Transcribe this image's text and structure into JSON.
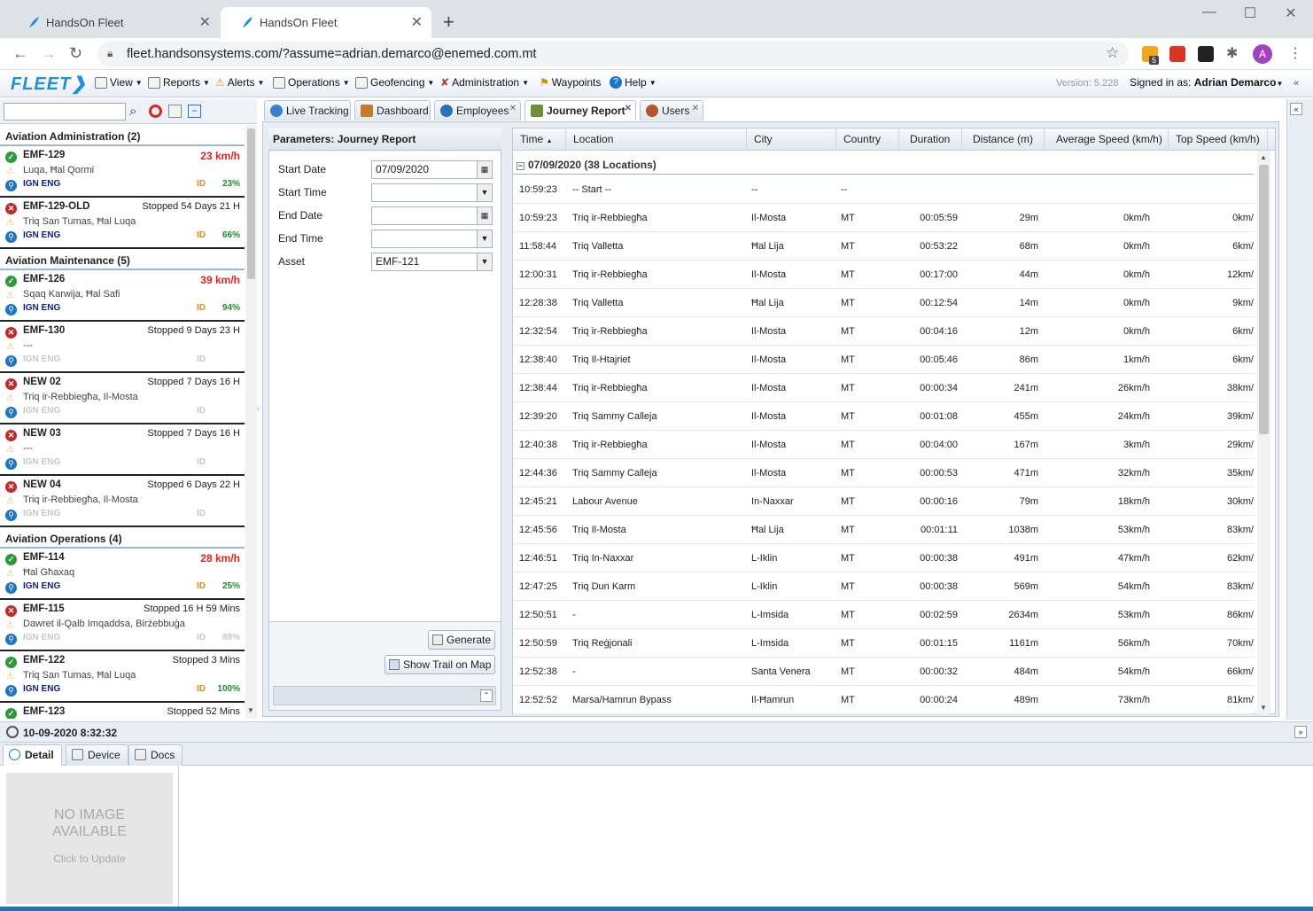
{
  "browser": {
    "tabs": [
      {
        "title": "HandsOn Fleet"
      },
      {
        "title": "HandsOn Fleet"
      }
    ],
    "url": "fleet.handsonsystems.com/?assume=adrian.demarco@enemed.com.mt",
    "profile_initial": "A",
    "ext_badge": "5"
  },
  "app": {
    "logo": "FLEET❯",
    "menu": [
      "View",
      "Reports",
      "Alerts",
      "Operations",
      "Geofencing",
      "Administration",
      "Waypoints",
      "Help"
    ],
    "version": "Version: 5.228",
    "signed_in_label": "Signed in as:",
    "user": "Adrian Demarco"
  },
  "groups": [
    {
      "title": "Aviation Administration (2)",
      "assets": [
        {
          "name": "EMF-129",
          "status": "23 km/h",
          "moving": true,
          "addr": "Luqa, Ħal Qormi",
          "ign": "IGN ENG",
          "ign_on": true,
          "id": "ID",
          "pct": "23%",
          "ok": true
        },
        {
          "name": "EMF-129-OLD",
          "status": "Stopped 54 Days 21 H",
          "moving": false,
          "addr": "Triq San Tumas, Ħal Luqa",
          "ign": "IGN ENG",
          "ign_on": true,
          "id": "ID",
          "pct": "66%",
          "ok": false
        }
      ]
    },
    {
      "title": "Aviation Maintenance (5)",
      "assets": [
        {
          "name": "EMF-126",
          "status": "39 km/h",
          "moving": true,
          "addr": "Sqaq Karwija, Ħal Safi",
          "ign": "IGN ENG",
          "ign_on": true,
          "id": "ID",
          "pct": "94%",
          "ok": true
        },
        {
          "name": "EMF-130",
          "status": "Stopped 9 Days 23 H",
          "moving": false,
          "addr": "---",
          "ign": "IGN ENG",
          "ign_on": false,
          "id": "ID",
          "pct": "",
          "ok": false
        },
        {
          "name": "NEW 02",
          "status": "Stopped 7 Days 16 H",
          "moving": false,
          "addr": "Triq ir-Rebbiegħa, Il-Mosta",
          "ign": "IGN ENG",
          "ign_on": false,
          "id": "ID",
          "pct": "",
          "ok": false
        },
        {
          "name": "NEW 03",
          "status": "Stopped 7 Days 16 H",
          "moving": false,
          "addr": "---",
          "ign": "IGN ENG",
          "ign_on": false,
          "id": "ID",
          "pct": "",
          "ok": false
        },
        {
          "name": "NEW 04",
          "status": "Stopped 6 Days 22 H",
          "moving": false,
          "addr": "Triq ir-Rebbiegħa, Il-Mosta",
          "ign": "IGN ENG",
          "ign_on": false,
          "id": "ID",
          "pct": "",
          "ok": false
        }
      ]
    },
    {
      "title": "Aviation Operations (4)",
      "assets": [
        {
          "name": "EMF-114",
          "status": "28 km/h",
          "moving": true,
          "addr": "Ħal Għaxaq",
          "ign": "IGN ENG",
          "ign_on": true,
          "id": "ID",
          "pct": "25%",
          "ok": true
        },
        {
          "name": "EMF-115",
          "status": "Stopped 16 H 59 Mins",
          "moving": false,
          "addr": "Dawret il-Qalb Imqaddsa, Birżebbuġa",
          "ign": "IGN ENG",
          "ign_on": false,
          "id": "ID",
          "pct": "88%",
          "ok": false
        },
        {
          "name": "EMF-122",
          "status": "Stopped 3 Mins",
          "moving": false,
          "addr": "Triq San Tumas, Ħal Luqa",
          "ign": "IGN ENG",
          "ign_on": true,
          "id": "ID",
          "pct": "100%",
          "ok": true
        },
        {
          "name": "EMF-123",
          "status": "Stopped 52 Mins",
          "moving": false,
          "addr": "",
          "ign": "",
          "ign_on": false,
          "id": "",
          "pct": "",
          "ok": true
        }
      ]
    }
  ],
  "tabs": [
    "Live Tracking",
    "Dashboard",
    "Employees",
    "Journey Report",
    "Users"
  ],
  "params": {
    "title": "Parameters: Journey Report",
    "start_date_label": "Start Date",
    "start_date": "07/09/2020",
    "start_time_label": "Start Time",
    "start_time": "",
    "end_date_label": "End Date",
    "end_date": "",
    "end_time_label": "End Time",
    "end_time": "",
    "asset_label": "Asset",
    "asset": "EMF-121",
    "generate": "Generate",
    "show_trail": "Show Trail on Map"
  },
  "grid": {
    "columns": [
      "Time",
      "Location",
      "City",
      "Country",
      "Duration",
      "Distance (m)",
      "Average Speed (km/h)",
      "Top Speed (km/h)"
    ],
    "group": "07/09/2020 (38 Locations)",
    "rows": [
      [
        "10:59:23",
        "-- Start --",
        "--",
        "--",
        "",
        "",
        "",
        ""
      ],
      [
        "10:59:23",
        "Triq ir-Rebbiegħa",
        "Il-Mosta",
        "MT",
        "00:05:59",
        "29m",
        "0km/h",
        "0km/"
      ],
      [
        "11:58:44",
        "Triq Valletta",
        "Ħal Lija",
        "MT",
        "00:53:22",
        "68m",
        "0km/h",
        "6km/"
      ],
      [
        "12:00:31",
        "Triq ir-Rebbiegħa",
        "Il-Mosta",
        "MT",
        "00:17:00",
        "44m",
        "0km/h",
        "12km/"
      ],
      [
        "12:28:38",
        "Triq Valletta",
        "Ħal Lija",
        "MT",
        "00:12:54",
        "14m",
        "0km/h",
        "9km/"
      ],
      [
        "12:32:54",
        "Triq ir-Rebbiegħa",
        "Il-Mosta",
        "MT",
        "00:04:16",
        "12m",
        "0km/h",
        "6km/"
      ],
      [
        "12:38:40",
        "Triq Il-Htajriet",
        "Il-Mosta",
        "MT",
        "00:05:46",
        "86m",
        "1km/h",
        "6km/"
      ],
      [
        "12:38:44",
        "Triq ir-Rebbiegħa",
        "Il-Mosta",
        "MT",
        "00:00:34",
        "241m",
        "26km/h",
        "38km/"
      ],
      [
        "12:39:20",
        "Triq Sammy Calleja",
        "Il-Mosta",
        "MT",
        "00:01:08",
        "455m",
        "24km/h",
        "39km/"
      ],
      [
        "12:40:38",
        "Triq ir-Rebbiegħa",
        "Il-Mosta",
        "MT",
        "00:04:00",
        "167m",
        "3km/h",
        "29km/"
      ],
      [
        "12:44:36",
        "Triq Sammy Calleja",
        "Il-Mosta",
        "MT",
        "00:00:53",
        "471m",
        "32km/h",
        "35km/"
      ],
      [
        "12:45:21",
        "Labour Avenue",
        "In-Naxxar",
        "MT",
        "00:00:16",
        "79m",
        "18km/h",
        "30km/"
      ],
      [
        "12:45:56",
        "Triq Il-Mosta",
        "Ħal Lija",
        "MT",
        "00:01:11",
        "1038m",
        "53km/h",
        "83km/"
      ],
      [
        "12:46:51",
        "Triq In-Naxxar",
        "L-Iklin",
        "MT",
        "00:00:38",
        "491m",
        "47km/h",
        "62km/"
      ],
      [
        "12:47:25",
        "Triq Dun Karm",
        "L-Iklin",
        "MT",
        "00:00:38",
        "569m",
        "54km/h",
        "83km/"
      ],
      [
        "12:50:51",
        "-",
        "L-Imsida",
        "MT",
        "00:02:59",
        "2634m",
        "53km/h",
        "86km/"
      ],
      [
        "12:50:59",
        "Triq Reġjonali",
        "L-Imsida",
        "MT",
        "00:01:15",
        "1161m",
        "56km/h",
        "70km/"
      ],
      [
        "12:52:38",
        "-",
        "Santa Venera",
        "MT",
        "00:00:32",
        "484m",
        "54km/h",
        "66km/"
      ],
      [
        "12:52:52",
        "Marsa/Hamrun Bypass",
        "Il-Ħamrun",
        "MT",
        "00:00:24",
        "489m",
        "73km/h",
        "81km/"
      ]
    ]
  },
  "status_time": "10-09-2020 8:32:32",
  "detail_tabs": [
    "Detail",
    "Device",
    "Docs"
  ],
  "noimage": {
    "line1": "NO IMAGE",
    "line2": "AVAILABLE",
    "cta": "Click to Update"
  }
}
